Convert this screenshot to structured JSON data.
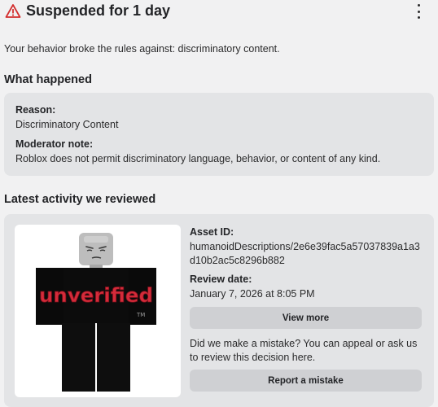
{
  "header": {
    "title": "Suspended for 1 day",
    "icon": "warning-triangle-icon",
    "menu_icon": "kebab-menu-icon"
  },
  "intro": "Your behavior broke the rules against: discriminatory content.",
  "what_happened": {
    "heading": "What happened",
    "reason_label": "Reason:",
    "reason_value": "Discriminatory Content",
    "moderator_label": "Moderator note:",
    "moderator_value": "Roblox does not permit discriminatory language, behavior, or content of any kind."
  },
  "latest_activity": {
    "heading": "Latest activity we reviewed",
    "asset_label": "Asset ID:",
    "asset_line_1": "humanoidDescriptions/2e6e39fac5a57037839a1a3",
    "asset_line_2": "d10b2ac5c8296b882",
    "date_label": "Review date:",
    "date_value": "January 7, 2026 at 8:05 PM",
    "view_more_label": "View more",
    "mistake_line_1": "Did we make a mistake? You can appeal or ask us",
    "mistake_line_2": "to review this decision here.",
    "report_label": "Report a mistake",
    "avatar_shirt_text": "unverified",
    "avatar_tm": "TM"
  },
  "colors": {
    "warning_red": "#d32f2f",
    "card_bg": "#e3e4e6",
    "button_bg": "#cfd0d3",
    "page_bg": "#f1f1f2"
  }
}
